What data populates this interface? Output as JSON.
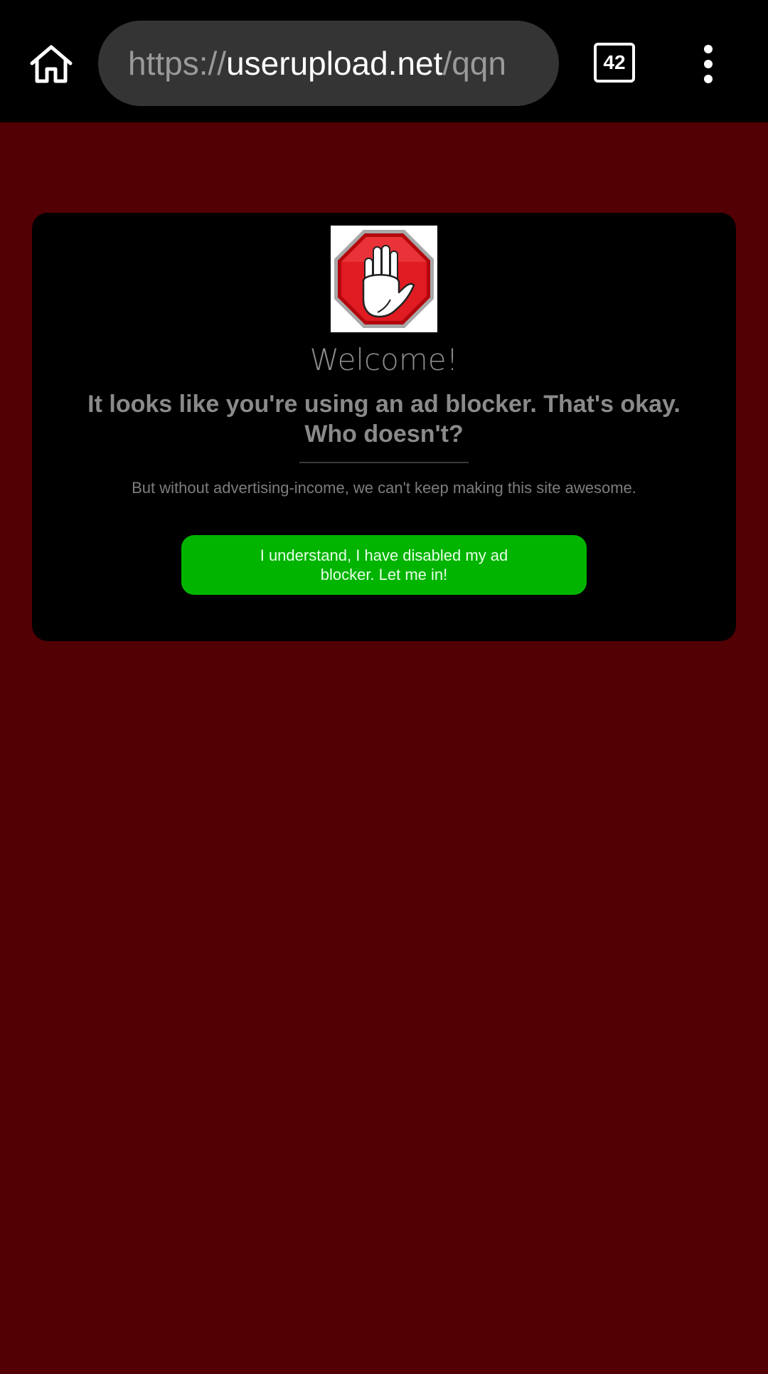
{
  "browser": {
    "url_scheme": "https://",
    "url_host": "userupload.net",
    "url_path": "/qqn",
    "tab_count": "42",
    "icons": {
      "home": "home-icon",
      "menu": "more-vert-icon"
    }
  },
  "dialog": {
    "image": "stop-hand-icon",
    "welcome": "Welcome!",
    "heading": "It looks like you're using an ad blocker. That's okay. Who doesn't?",
    "subtext": "But without advertising-income, we can't keep making this site awesome.",
    "button_label": "I understand, I have disabled my ad blocker. Let me in!"
  },
  "colors": {
    "page_background": "#520004",
    "dialog_background": "#000000",
    "button_background": "#00b400"
  }
}
